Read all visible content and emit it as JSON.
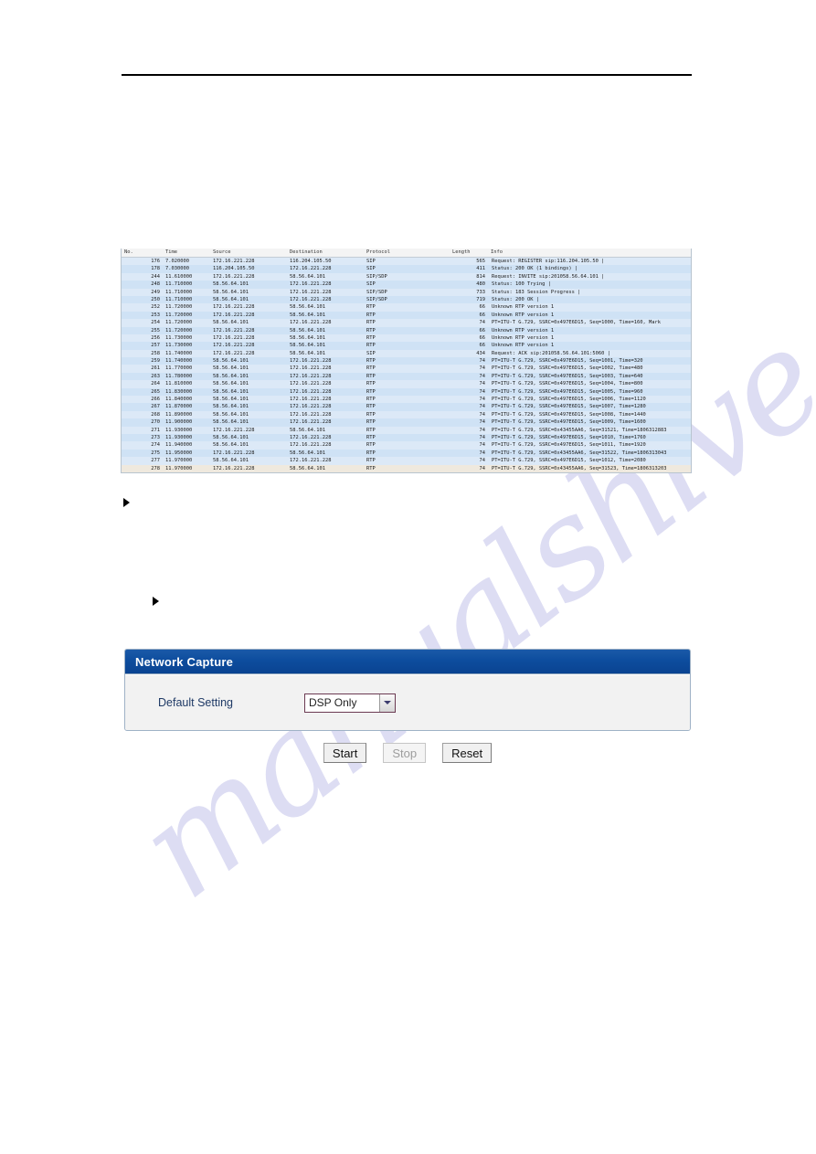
{
  "page": {
    "watermark_text": "manualshive.com"
  },
  "capture_table": {
    "columns": [
      "No.",
      "Time",
      "Source",
      "Destination",
      "Protocol",
      "Length",
      "Info"
    ],
    "rows": [
      {
        "no": "176",
        "time": "7.020000",
        "source": "172.16.221.228",
        "destination": "116.204.105.50",
        "protocol": "SIP",
        "length": "565",
        "info": "Request: REGISTER sip:116.204.105.50 |"
      },
      {
        "no": "178",
        "time": "7.030000",
        "source": "116.204.105.50",
        "destination": "172.16.221.228",
        "protocol": "SIP",
        "length": "411",
        "info": "Status: 200 OK    (1 bindings) |"
      },
      {
        "no": "244",
        "time": "11.610000",
        "source": "172.16.221.228",
        "destination": "58.56.64.101",
        "protocol": "SIP/SDP",
        "length": "814",
        "info": "Request: INVITE sip:201058.56.64.101 |"
      },
      {
        "no": "248",
        "time": "11.710000",
        "source": "58.56.64.101",
        "destination": "172.16.221.228",
        "protocol": "SIP",
        "length": "480",
        "info": "Status: 100 Trying |"
      },
      {
        "no": "249",
        "time": "11.710000",
        "source": "58.56.64.101",
        "destination": "172.16.221.228",
        "protocol": "SIP/SDP",
        "length": "733",
        "info": "Status: 183 Session Progress |"
      },
      {
        "no": "250",
        "time": "11.710000",
        "source": "58.56.64.101",
        "destination": "172.16.221.228",
        "protocol": "SIP/SDP",
        "length": "719",
        "info": "Status: 200 OK |"
      },
      {
        "no": "252",
        "time": "11.720000",
        "source": "172.16.221.228",
        "destination": "58.56.64.101",
        "protocol": "RTP",
        "length": "66",
        "info": "Unknown RTP version 1"
      },
      {
        "no": "253",
        "time": "11.720000",
        "source": "172.16.221.228",
        "destination": "58.56.64.101",
        "protocol": "RTP",
        "length": "66",
        "info": "Unknown RTP version 1"
      },
      {
        "no": "254",
        "time": "11.720000",
        "source": "58.56.64.101",
        "destination": "172.16.221.228",
        "protocol": "RTP",
        "length": "74",
        "info": "PT=ITU-T G.729, SSRC=0x497E6D15, Seq=1000, Time=160, Mark"
      },
      {
        "no": "255",
        "time": "11.720000",
        "source": "172.16.221.228",
        "destination": "58.56.64.101",
        "protocol": "RTP",
        "length": "66",
        "info": "Unknown RTP version 1"
      },
      {
        "no": "256",
        "time": "11.730000",
        "source": "172.16.221.228",
        "destination": "58.56.64.101",
        "protocol": "RTP",
        "length": "66",
        "info": "Unknown RTP version 1"
      },
      {
        "no": "257",
        "time": "11.730000",
        "source": "172.16.221.228",
        "destination": "58.56.64.101",
        "protocol": "RTP",
        "length": "66",
        "info": "Unknown RTP version 1"
      },
      {
        "no": "258",
        "time": "11.740000",
        "source": "172.16.221.228",
        "destination": "58.56.64.101",
        "protocol": "SIP",
        "length": "434",
        "info": "Request: ACK sip:201058.56.64.101:5060 |"
      },
      {
        "no": "259",
        "time": "11.740000",
        "source": "58.56.64.101",
        "destination": "172.16.221.228",
        "protocol": "RTP",
        "length": "74",
        "info": "PT=ITU-T G.729, SSRC=0x497E6D15, Seq=1001, Time=320"
      },
      {
        "no": "261",
        "time": "11.770000",
        "source": "58.56.64.101",
        "destination": "172.16.221.228",
        "protocol": "RTP",
        "length": "74",
        "info": "PT=ITU-T G.729, SSRC=0x497E6D15, Seq=1002, Time=480"
      },
      {
        "no": "263",
        "time": "11.780000",
        "source": "58.56.64.101",
        "destination": "172.16.221.228",
        "protocol": "RTP",
        "length": "74",
        "info": "PT=ITU-T G.729, SSRC=0x497E6D15, Seq=1003, Time=640"
      },
      {
        "no": "264",
        "time": "11.810000",
        "source": "58.56.64.101",
        "destination": "172.16.221.228",
        "protocol": "RTP",
        "length": "74",
        "info": "PT=ITU-T G.729, SSRC=0x497E6D15, Seq=1004, Time=800"
      },
      {
        "no": "265",
        "time": "11.830000",
        "source": "58.56.64.101",
        "destination": "172.16.221.228",
        "protocol": "RTP",
        "length": "74",
        "info": "PT=ITU-T G.729, SSRC=0x497E6D15, Seq=1005, Time=960"
      },
      {
        "no": "266",
        "time": "11.840000",
        "source": "58.56.64.101",
        "destination": "172.16.221.228",
        "protocol": "RTP",
        "length": "74",
        "info": "PT=ITU-T G.729, SSRC=0x497E6D15, Seq=1006, Time=1120"
      },
      {
        "no": "267",
        "time": "11.870000",
        "source": "58.56.64.101",
        "destination": "172.16.221.228",
        "protocol": "RTP",
        "length": "74",
        "info": "PT=ITU-T G.729, SSRC=0x497E6D15, Seq=1007, Time=1280"
      },
      {
        "no": "268",
        "time": "11.890000",
        "source": "58.56.64.101",
        "destination": "172.16.221.228",
        "protocol": "RTP",
        "length": "74",
        "info": "PT=ITU-T G.729, SSRC=0x497E6D15, Seq=1008, Time=1440"
      },
      {
        "no": "270",
        "time": "11.900000",
        "source": "58.56.64.101",
        "destination": "172.16.221.228",
        "protocol": "RTP",
        "length": "74",
        "info": "PT=ITU-T G.729, SSRC=0x497E6D15, Seq=1009, Time=1600"
      },
      {
        "no": "271",
        "time": "11.930000",
        "source": "172.16.221.228",
        "destination": "58.56.64.101",
        "protocol": "RTP",
        "length": "74",
        "info": "PT=ITU-T G.729, SSRC=0x43455AA6, Seq=31521, Time=1806312883"
      },
      {
        "no": "273",
        "time": "11.930000",
        "source": "58.56.64.101",
        "destination": "172.16.221.228",
        "protocol": "RTP",
        "length": "74",
        "info": "PT=ITU-T G.729, SSRC=0x497E6D15, Seq=1010, Time=1760"
      },
      {
        "no": "274",
        "time": "11.940000",
        "source": "58.56.64.101",
        "destination": "172.16.221.228",
        "protocol": "RTP",
        "length": "74",
        "info": "PT=ITU-T G.729, SSRC=0x497E6D15, Seq=1011, Time=1920"
      },
      {
        "no": "275",
        "time": "11.950000",
        "source": "172.16.221.228",
        "destination": "58.56.64.101",
        "protocol": "RTP",
        "length": "74",
        "info": "PT=ITU-T G.729, SSRC=0x43455AA6, Seq=31522, Time=1806313043"
      },
      {
        "no": "277",
        "time": "11.970000",
        "source": "58.56.64.101",
        "destination": "172.16.221.228",
        "protocol": "RTP",
        "length": "74",
        "info": "PT=ITU-T G.729, SSRC=0x497E6D15, Seq=1012, Time=2080"
      },
      {
        "no": "278",
        "time": "11.970000",
        "source": "172.16.221.228",
        "destination": "58.56.64.101",
        "protocol": "RTP",
        "length": "74",
        "info": "PT=ITU-T G.729, SSRC=0x43455AA6, Seq=31523, Time=1806313203"
      }
    ],
    "selected_row_index": 27
  },
  "network_capture": {
    "title": "Network Capture",
    "default_setting_label": "Default Setting",
    "default_setting_value": "DSP Only",
    "default_setting_options": [
      "DSP Only"
    ],
    "dropdown_icon": "chevron-down-icon",
    "header_color": "#0d4d9e"
  },
  "actions": {
    "start_label": "Start",
    "stop_label": "Stop",
    "reset_label": "Reset",
    "stop_disabled": true
  }
}
